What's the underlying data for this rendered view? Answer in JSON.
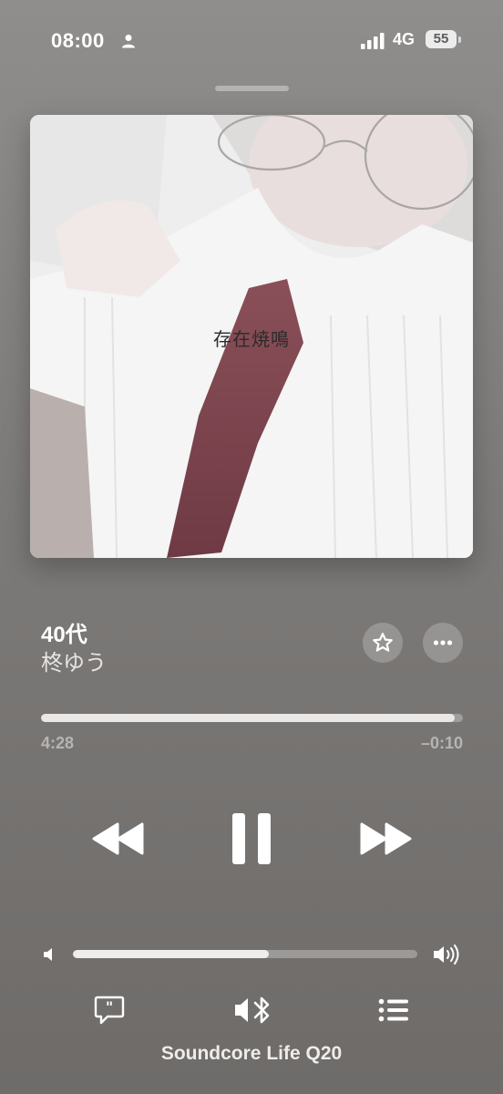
{
  "status_bar": {
    "time": "08:00",
    "network": "4G",
    "battery": "55",
    "icons": [
      "person-icon",
      "signal-bars-icon",
      "battery-icon"
    ]
  },
  "artwork": {
    "text": "存在焼鳴"
  },
  "track": {
    "title": "40代",
    "artist": "柊ゆう"
  },
  "actions": {
    "favorite_icon": "star-icon",
    "more_icon": "ellipsis-icon"
  },
  "progress": {
    "elapsed": "4:28",
    "remaining": "–0:10",
    "fraction": 0.98
  },
  "controls": {
    "rewind_icon": "rewind-icon",
    "pause_icon": "pause-icon",
    "forward_icon": "fast-forward-icon"
  },
  "volume": {
    "level": 0.57,
    "low_icon": "speaker-low-icon",
    "high_icon": "speaker-high-icon"
  },
  "bottom_bar": {
    "lyrics_icon": "lyrics-icon",
    "output_icon": "bluetooth-speaker-icon",
    "queue_icon": "queue-list-icon",
    "device_name": "Soundcore Life Q20"
  },
  "colors": {
    "background": "#7d7b79",
    "foreground": "#ffffff",
    "secondary_text": "#b7b5b3"
  }
}
